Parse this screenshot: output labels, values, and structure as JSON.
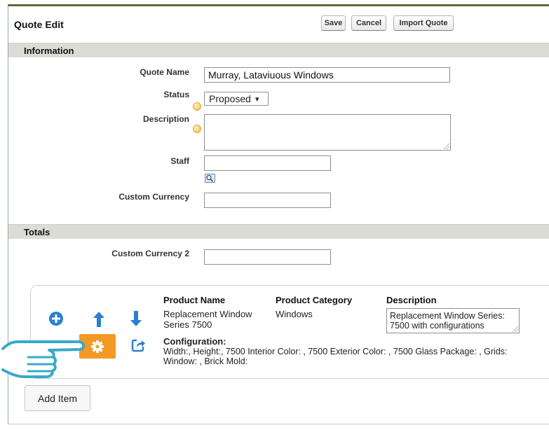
{
  "header": {
    "title": "Quote Edit",
    "save_label": "Save",
    "cancel_label": "Cancel",
    "import_label": "Import Quote"
  },
  "information": {
    "section_title": "Information",
    "quote_name_label": "Quote Name",
    "quote_name_value": "Murray, Lataviuous Windows",
    "status_label": "Status",
    "status_value": "Proposed",
    "status_arrow": "▾",
    "description_label": "Description",
    "description_value": "",
    "staff_label": "Staff",
    "staff_value": "",
    "custom_currency_label": "Custom Currency",
    "custom_currency_value": ""
  },
  "totals": {
    "section_title": "Totals",
    "custom_currency_2_label": "Custom Currency 2",
    "custom_currency_2_value": ""
  },
  "line_item": {
    "headers": {
      "product_name": "Product Name",
      "product_category": "Product Category",
      "description": "Description"
    },
    "product_name_line1": "Replacement Window",
    "product_name_line2": "Series 7500",
    "product_category": "Windows",
    "description_line1": "Replacement Window Series:",
    "description_line2": "7500 with configurations",
    "configuration_title": "Configuration:",
    "configuration_text": "Width:, Height:, 7500 Interior Color: , 7500 Exterior Color: , 7500 Glass Package: , Grids: Window: , Brick Mold:",
    "icons": {
      "add": "plus-circle-icon",
      "move_up": "arrow-up-icon",
      "move_down": "arrow-down-icon",
      "configure": "gear-icon",
      "share": "share-icon"
    }
  },
  "footer": {
    "add_item_label": "Add Item"
  },
  "colors": {
    "accent_blue": "#2a7fd4",
    "gear_orange": "#f39a26",
    "section_bar": "#dcdcd6",
    "top_border": "#5f6a3f",
    "pointer_hand": "#39a9c9"
  }
}
